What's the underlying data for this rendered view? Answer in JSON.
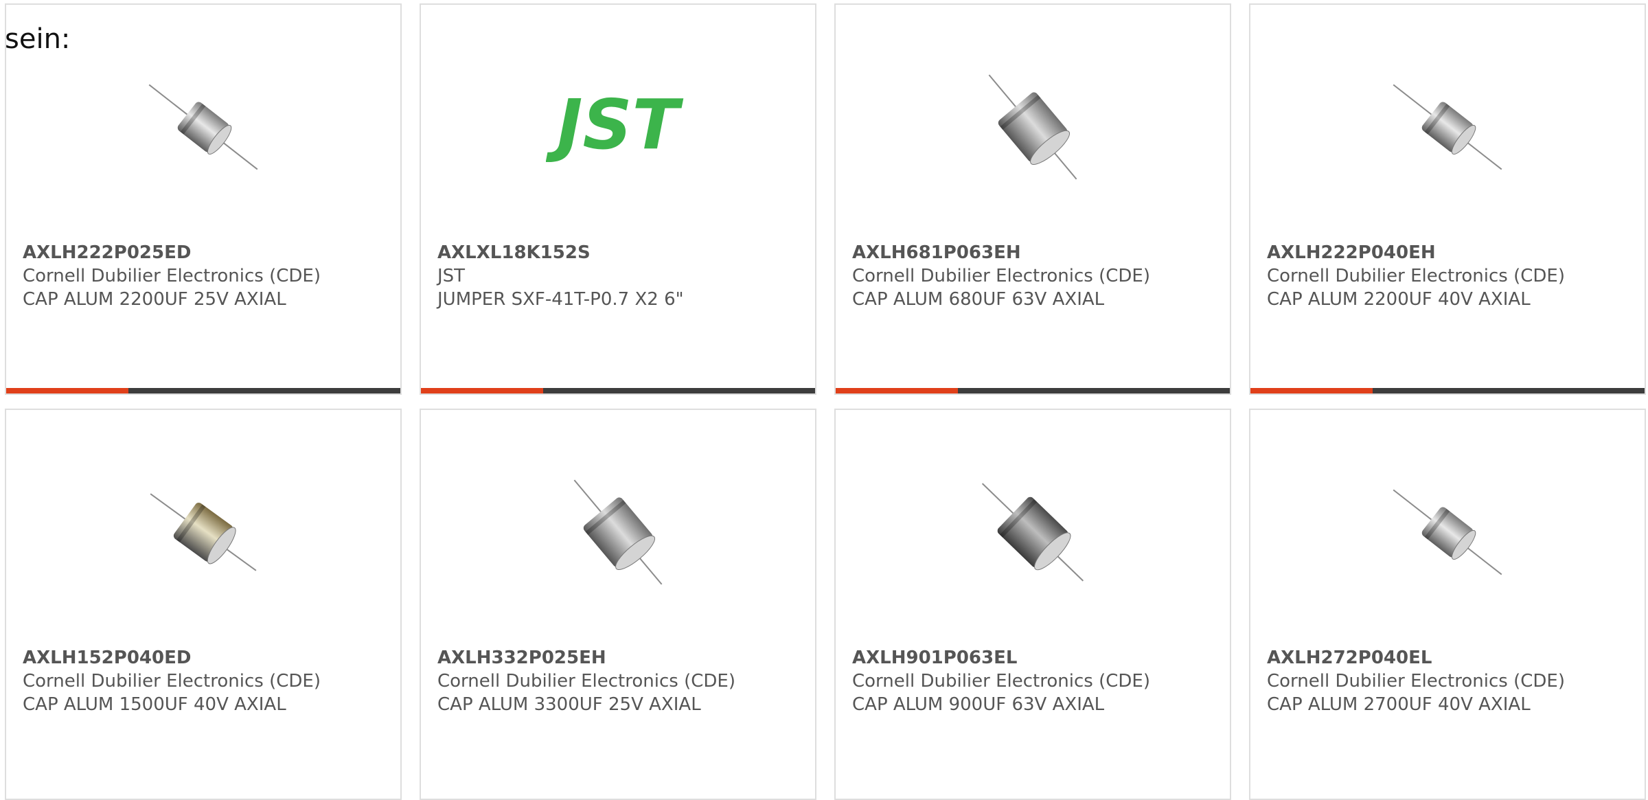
{
  "lead_text": "sein:",
  "accent_color": "#e0401a",
  "bar_color": "#3d3d3d",
  "products": [
    {
      "part_number": "AXLH222P025ED",
      "manufacturer": "Cornell Dubilier Electronics (CDE)",
      "description": "CAP ALUM 2200UF 25V AXIAL",
      "image": "axial-capacitor-small",
      "accent_fraction": 0.31
    },
    {
      "part_number": "AXLXL18K152S",
      "manufacturer": "JST",
      "description": "JUMPER SXF-41T-P0.7 X2 6\"",
      "image": "jst-logo",
      "logo_text": "JST",
      "logo_color": "#3cb44b",
      "accent_fraction": 0.31
    },
    {
      "part_number": "AXLH681P063EH",
      "manufacturer": "Cornell Dubilier Electronics (CDE)",
      "description": "CAP ALUM 680UF 63V AXIAL",
      "image": "axial-capacitor-large",
      "accent_fraction": 0.31
    },
    {
      "part_number": "AXLH222P040EH",
      "manufacturer": "Cornell Dubilier Electronics (CDE)",
      "description": "CAP ALUM 2200UF 40V AXIAL",
      "image": "axial-capacitor-small",
      "accent_fraction": 0.31
    },
    {
      "part_number": "AXLH152P040ED",
      "manufacturer": "Cornell Dubilier Electronics (CDE)",
      "description": "CAP ALUM 1500UF 40V AXIAL",
      "image": "axial-capacitor-gold",
      "accent_fraction": 0
    },
    {
      "part_number": "AXLH332P025EH",
      "manufacturer": "Cornell Dubilier Electronics (CDE)",
      "description": "CAP ALUM 3300UF 25V AXIAL",
      "image": "axial-capacitor-large",
      "accent_fraction": 0
    },
    {
      "part_number": "AXLH901P063EL",
      "manufacturer": "Cornell Dubilier Electronics (CDE)",
      "description": "CAP ALUM 900UF 63V AXIAL",
      "image": "axial-capacitor-dark",
      "accent_fraction": 0
    },
    {
      "part_number": "AXLH272P040EL",
      "manufacturer": "Cornell Dubilier Electronics (CDE)",
      "description": "CAP ALUM 2700UF 40V AXIAL",
      "image": "axial-capacitor-small",
      "accent_fraction": 0
    }
  ]
}
